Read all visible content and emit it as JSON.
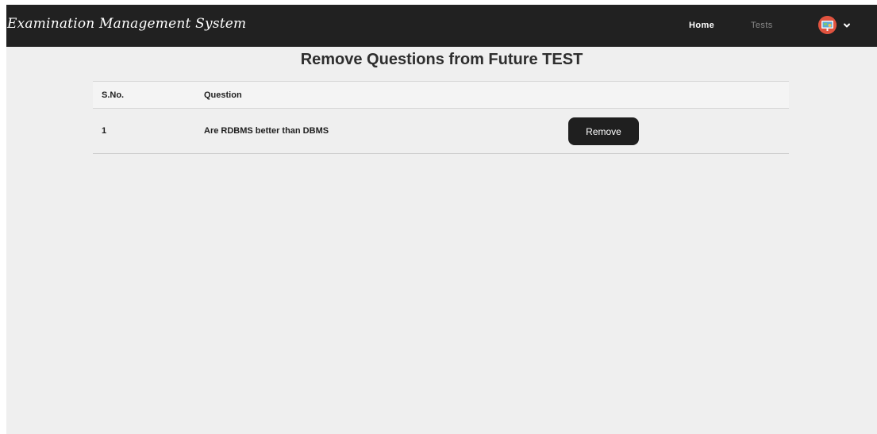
{
  "navbar": {
    "brand": "Examination Management System",
    "links": [
      {
        "label": "Home"
      },
      {
        "label": "Tests"
      }
    ],
    "avatar_icon": "presentation-board-icon",
    "menu_icon": "chevron-down-icon"
  },
  "page": {
    "title": "Remove Questions from Future TEST"
  },
  "table": {
    "headers": [
      "S.No.",
      "Question"
    ],
    "rows": [
      {
        "sno": "1",
        "question": "Are RDBMS better than DBMS",
        "action_label": "Remove"
      }
    ]
  },
  "colors": {
    "navbar_bg": "#212121",
    "page_bg": "#efefef",
    "button_bg": "#1f1f1f",
    "avatar_bg": "#e0533f"
  }
}
